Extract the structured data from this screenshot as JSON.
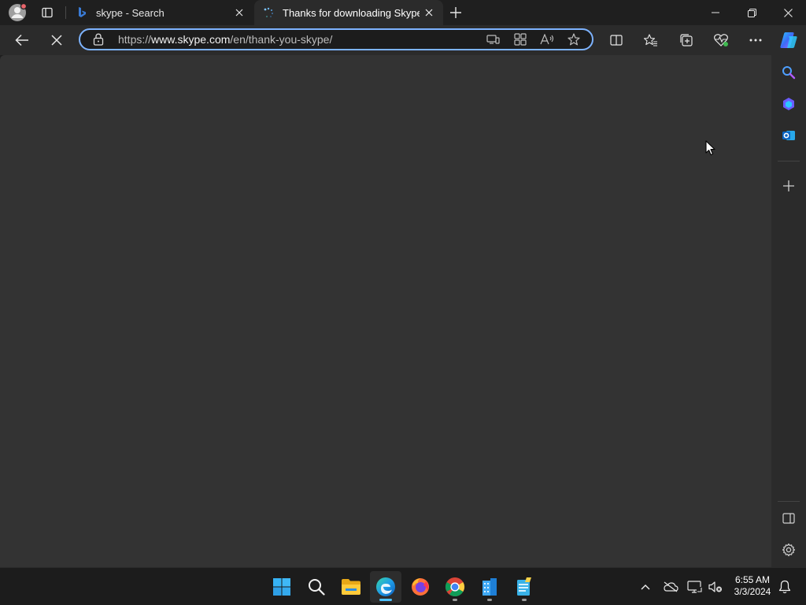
{
  "browser": {
    "tabs": [
      {
        "title": "skype - Search",
        "favicon": "bing-icon",
        "active": false
      },
      {
        "title": "Thanks for downloading Skype",
        "favicon": "loading-spinner-icon",
        "active": true
      }
    ],
    "address": {
      "scheme": "https://",
      "host": "www.skype.com",
      "path": "/en/thank-you-skype/"
    },
    "accent": "#7db3ff"
  },
  "taskbar": {
    "apps": [
      "start-icon",
      "search-icon",
      "file-explorer-icon",
      "edge-icon",
      "firefox-icon",
      "chrome-icon",
      "app-building-icon",
      "app-notepad-icon"
    ],
    "clock": {
      "time": "6:55 AM",
      "date": "3/3/2024"
    }
  }
}
